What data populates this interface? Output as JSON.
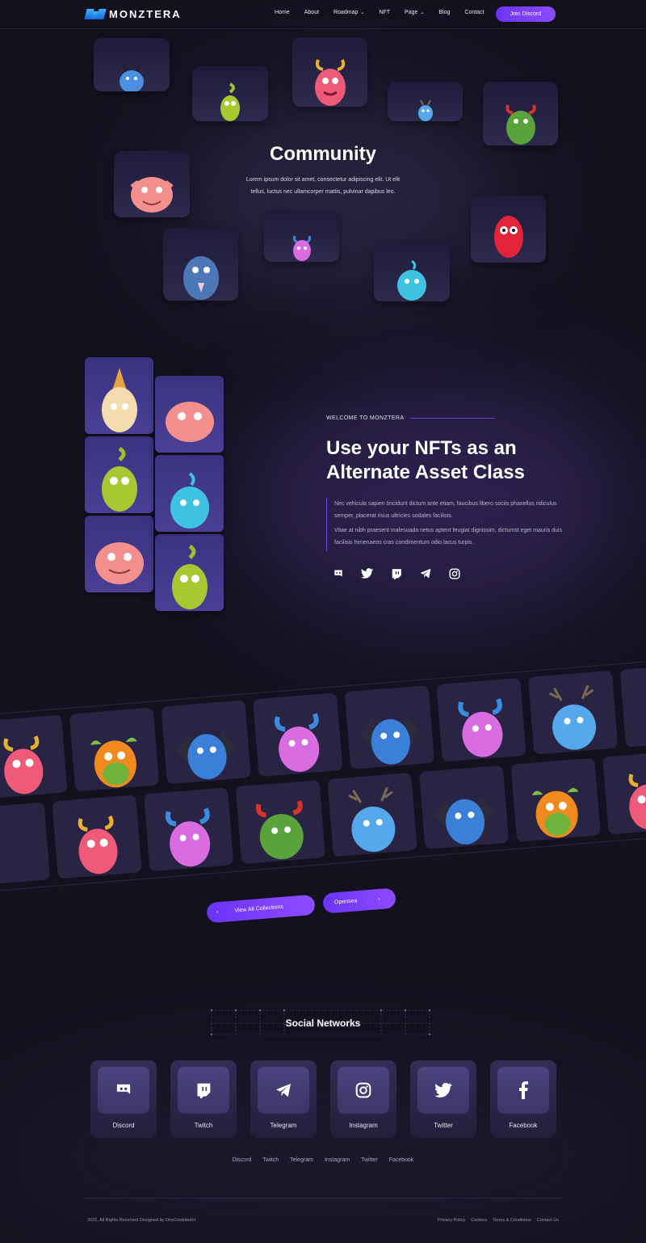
{
  "brand": {
    "name": "MONZTERA"
  },
  "nav": {
    "items": [
      {
        "label": "Home"
      },
      {
        "label": "About"
      },
      {
        "label": "Roadmap",
        "dropdown": true
      },
      {
        "label": "NFT"
      },
      {
        "label": "Page",
        "dropdown": true
      },
      {
        "label": "Blog"
      },
      {
        "label": "Contact"
      }
    ],
    "cta": "Join Discord"
  },
  "community": {
    "title": "Community",
    "text": "Lorem ipsum dolor sit amet, consectetur adipiscing elit. Ut elit tellus, luctus nec ullamcorper mattis, pulvinar dapibus leo."
  },
  "about": {
    "eyebrow": "WELCOME TO MONZTERA",
    "title": "Use your NFTs as an Alternate Asset Class",
    "paragraph_1": "Nec vehicula sapien tincidunt dictum ante etiam, faucibus libero sociis phasellus ridiculus semper, placerat risus ultricies sodales facilisis.",
    "paragraph_2": "Vitae at nibh praesent malesuada netus aptent feugiat dignissim, dictumst eget mauris duis facilisis himenaeos cras condimentum odio lacus turpis.",
    "social_icons": [
      "discord-icon",
      "twitter-icon",
      "twitch-icon",
      "telegram-icon",
      "instagram-icon"
    ]
  },
  "collection": {
    "view_all": "View All Collections",
    "opensea": "Opensea"
  },
  "social_networks": {
    "title": "Social Networks",
    "cards": [
      {
        "label": "Discord",
        "icon": "discord-icon"
      },
      {
        "label": "Twitch",
        "icon": "twitch-icon"
      },
      {
        "label": "Telegram",
        "icon": "telegram-icon"
      },
      {
        "label": "Instagram",
        "icon": "instagram-icon"
      },
      {
        "label": "Twitter",
        "icon": "twitter-icon"
      },
      {
        "label": "Facebook",
        "icon": "facebook-icon"
      }
    ],
    "links": [
      "Discord",
      "Twitch",
      "Telegram",
      "Instagram",
      "Twitter",
      "Facebook"
    ]
  },
  "footer": {
    "copyright": "2022, All Rights Reserved Designed by OneContributor",
    "legal": [
      "Privacy Policy",
      "Cookies",
      "Terms & Conditions",
      "Contact Us"
    ]
  },
  "colors": {
    "background": "#14111f",
    "accent": "#7a3ff8",
    "card": "#2a2444"
  }
}
